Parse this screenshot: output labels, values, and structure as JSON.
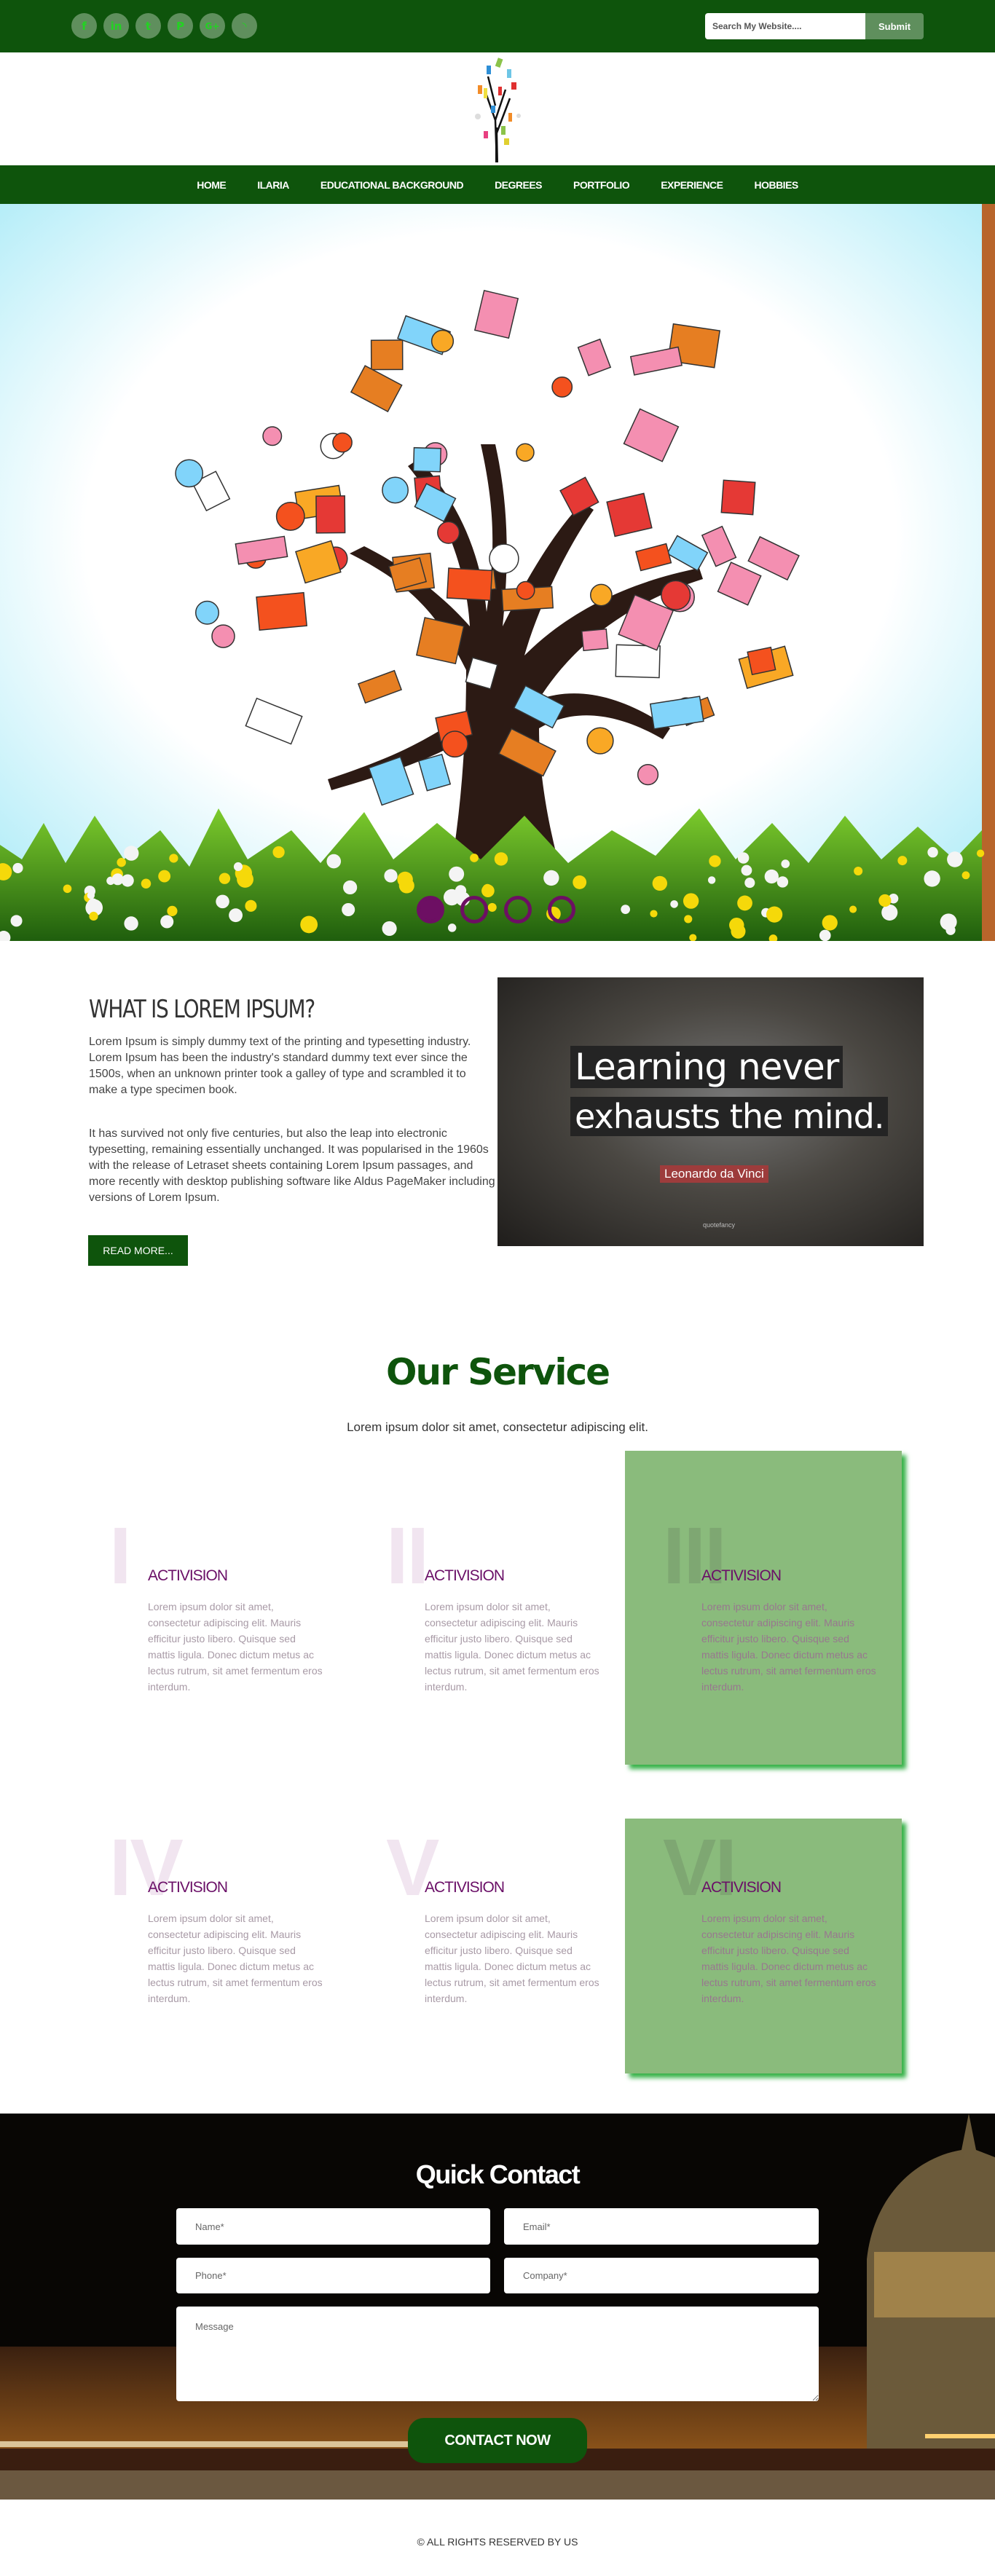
{
  "colors": {
    "brand_green": "#0e540c",
    "accent_purple": "#6d0f63",
    "card_green": "#8abb7c"
  },
  "topbar": {
    "social": [
      {
        "icon": "facebook-icon",
        "glyph": "f"
      },
      {
        "icon": "linkedin-icon",
        "glyph": "in"
      },
      {
        "icon": "twitter-icon",
        "glyph": "t"
      },
      {
        "icon": "pinterest-icon",
        "glyph": "P"
      },
      {
        "icon": "google-plus-icon",
        "glyph": "G+"
      },
      {
        "icon": "rss-icon",
        "glyph": "◝"
      }
    ],
    "search_placeholder": "Search My Website....",
    "submit_label": "Submit"
  },
  "nav": [
    "HOME",
    "ILARIA",
    "EDUCATIONAL BACKGROUND",
    "DEGREES",
    "PORTFOLIO",
    "EXPERIENCE",
    "HOBBIES"
  ],
  "slider": {
    "slides": 4,
    "active": 1
  },
  "about": {
    "heading": "WHAT IS LOREM IPSUM?",
    "paragraphs": [
      "Lorem Ipsum is simply dummy text of the printing and typesetting industry. Lorem Ipsum has been the industry's standard dummy text ever since the 1500s, when an unknown printer took a galley of type and scrambled it to make a type specimen book.",
      "It has survived not only five centuries, but also the leap into electronic typesetting, remaining essentially unchanged. It was popularised in the 1960s with the release of Letraset sheets containing Lorem Ipsum passages, and more recently with desktop publishing software like Aldus PageMaker including versions of Lorem Ipsum."
    ],
    "read_more": "READ MORE...",
    "quote": {
      "line1": "Learning never",
      "line2": "exhausts the mind.",
      "author": "Leonardo da Vinci",
      "watermark": "quotefancy"
    }
  },
  "services": {
    "title": "Our Service",
    "subtitle": "Lorem ipsum dolor sit amet, consectetur adipiscing elit.",
    "items": [
      {
        "numeral": "I",
        "title": "ACTIVISION",
        "text": "Lorem ipsum dolor sit amet, consectetur adipiscing elit. Mauris efficitur justo libero. Quisque sed mattis ligula. Donec dictum metus ac lectus rutrum, sit amet fermentum eros interdum.",
        "highlighted": false
      },
      {
        "numeral": "II",
        "title": "ACTIVISION",
        "text": "Lorem ipsum dolor sit amet, consectetur adipiscing elit. Mauris efficitur justo libero. Quisque sed mattis ligula. Donec dictum metus ac lectus rutrum, sit amet fermentum eros interdum.",
        "highlighted": false
      },
      {
        "numeral": "III",
        "title": "ACTIVISION",
        "text": "Lorem ipsum dolor sit amet, consectetur adipiscing elit. Mauris efficitur justo libero. Quisque sed mattis ligula. Donec dictum metus ac lectus rutrum, sit amet fermentum eros interdum.",
        "highlighted": true
      },
      {
        "numeral": "IV",
        "title": "ACTIVISION",
        "text": "Lorem ipsum dolor sit amet, consectetur adipiscing elit. Mauris efficitur justo libero. Quisque sed mattis ligula. Donec dictum metus ac lectus rutrum, sit amet fermentum eros interdum.",
        "highlighted": false
      },
      {
        "numeral": "V",
        "title": "ACTIVISION",
        "text": "Lorem ipsum dolor sit amet, consectetur adipiscing elit. Mauris efficitur justo libero. Quisque sed mattis ligula. Donec dictum metus ac lectus rutrum, sit amet fermentum eros interdum.",
        "highlighted": false
      },
      {
        "numeral": "VI",
        "title": "ACTIVISION",
        "text": "Lorem ipsum dolor sit amet, consectetur adipiscing elit. Mauris efficitur justo libero. Quisque sed mattis ligula. Donec dictum metus ac lectus rutrum, sit amet fermentum eros interdum.",
        "highlighted": true
      }
    ]
  },
  "contact": {
    "title": "Quick Contact",
    "name_placeholder": "Name*",
    "email_placeholder": "Email*",
    "phone_placeholder": "Phone*",
    "company_placeholder": "Company*",
    "message_placeholder": "Message",
    "button": "CONTACT NOW"
  },
  "footer": {
    "copyright": "© ALL RIGHTS RESERVED BY US"
  }
}
